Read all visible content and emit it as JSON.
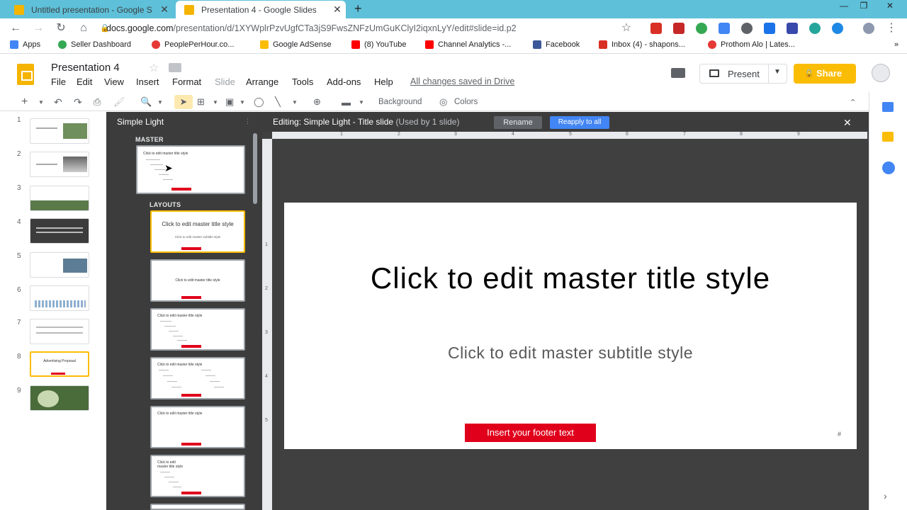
{
  "browser": {
    "tabs": [
      {
        "title": "Untitled presentation - Google S",
        "active": false
      },
      {
        "title": "Presentation 4 - Google Slides",
        "active": true
      }
    ],
    "new_tab": "+",
    "url_host": "docs.google.com",
    "url_path": "/presentation/d/1XYWplrPzvUgfCTa3jS9FwsZNFzUmGuKClyI2iqxnLyY/edit#slide=id.p2",
    "bookmarks": [
      {
        "label": "Apps",
        "color": "#4285f4"
      },
      {
        "label": "Seller Dashboard",
        "color": "#34a853"
      },
      {
        "label": "PeoplePerHour.co...",
        "color": "#e53935"
      },
      {
        "label": "Google AdSense",
        "color": "#fbbc04"
      },
      {
        "label": "(8) YouTube",
        "color": "#ff0000"
      },
      {
        "label": "Channel Analytics -...",
        "color": "#ff0000"
      },
      {
        "label": "Facebook",
        "color": "#3b5998"
      },
      {
        "label": "Inbox (4) - shapons...",
        "color": "#d93025"
      },
      {
        "label": "Prothom Alo | Lates...",
        "color": "#e53935"
      }
    ]
  },
  "app": {
    "doc_title": "Presentation 4",
    "menus": [
      "File",
      "Edit",
      "View",
      "Insert",
      "Format",
      "Slide",
      "Arrange",
      "Tools",
      "Add-ons",
      "Help"
    ],
    "saved_status": "All changes saved in Drive",
    "present_label": "Present",
    "share_label": "Share",
    "brand_color": "#f4b400",
    "share_color": "#fbbc04"
  },
  "toolbar": {
    "background_label": "Background",
    "colors_label": "Colors"
  },
  "filmstrip": {
    "slides": [
      {
        "num": "1"
      },
      {
        "num": "2"
      },
      {
        "num": "3"
      },
      {
        "num": "4"
      },
      {
        "num": "5"
      },
      {
        "num": "6"
      },
      {
        "num": "7"
      },
      {
        "num": "8",
        "selected": true,
        "title": "Advertising Proposal"
      },
      {
        "num": "9"
      }
    ]
  },
  "master_panel": {
    "theme_name": "Simple Light",
    "master_label": "MASTER",
    "layouts_label": "LAYOUTS",
    "master_thumb_title": "Click to edit master title style",
    "layouts": [
      {
        "title": "Click to edit master title style",
        "subtitle": "Click to edit master subtitle style",
        "selected": true
      },
      {
        "title": "Click to edit master title style"
      },
      {
        "title": "Click to edit master title style"
      },
      {
        "title": "Click to edit master title style"
      },
      {
        "title": "Click to edit master title style"
      },
      {
        "title": "Click to edit master title style"
      }
    ]
  },
  "editor": {
    "editing_label": "Editing: Simple Light - Title slide",
    "used_label": "(Used by 1 slide)",
    "rename_label": "Rename",
    "reapply_label": "Reapply to all",
    "ruler_top": [
      "1",
      "2",
      "3",
      "4",
      "5",
      "6",
      "7",
      "8",
      "9"
    ],
    "ruler_left": [
      "1",
      "2",
      "3",
      "4",
      "5"
    ]
  },
  "slide": {
    "title": "Click to edit master title style",
    "subtitle": "Click to edit master subtitle style",
    "footer": "Insert your footer text",
    "slide_number": "#",
    "footer_color": "#e0001b"
  }
}
